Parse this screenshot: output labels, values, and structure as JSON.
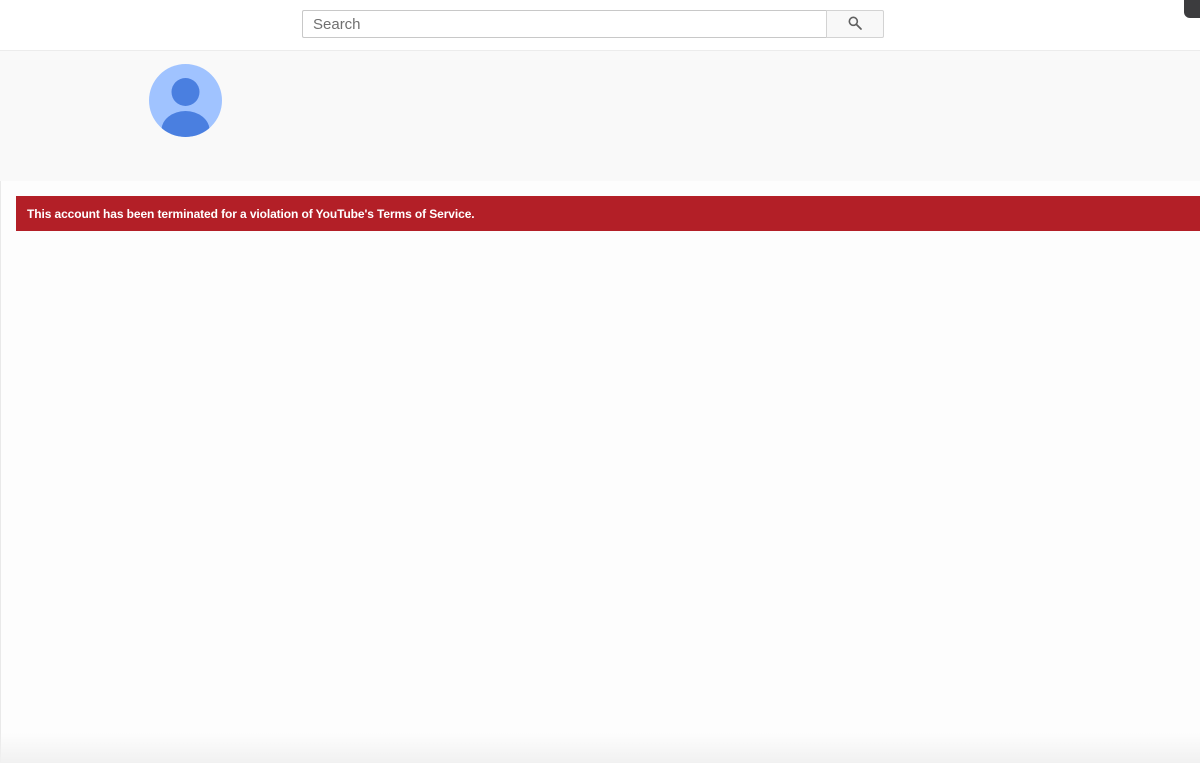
{
  "search": {
    "placeholder": "Search",
    "icon": "search-icon"
  },
  "channel": {
    "avatar_icon": "default-avatar-icon",
    "avatar_bg_color": "#a0c3ff",
    "avatar_fg_color": "#4a7fe0"
  },
  "alert": {
    "message": "This account has been terminated for a violation of YouTube's Terms of Service.",
    "color": "#b31f27"
  }
}
